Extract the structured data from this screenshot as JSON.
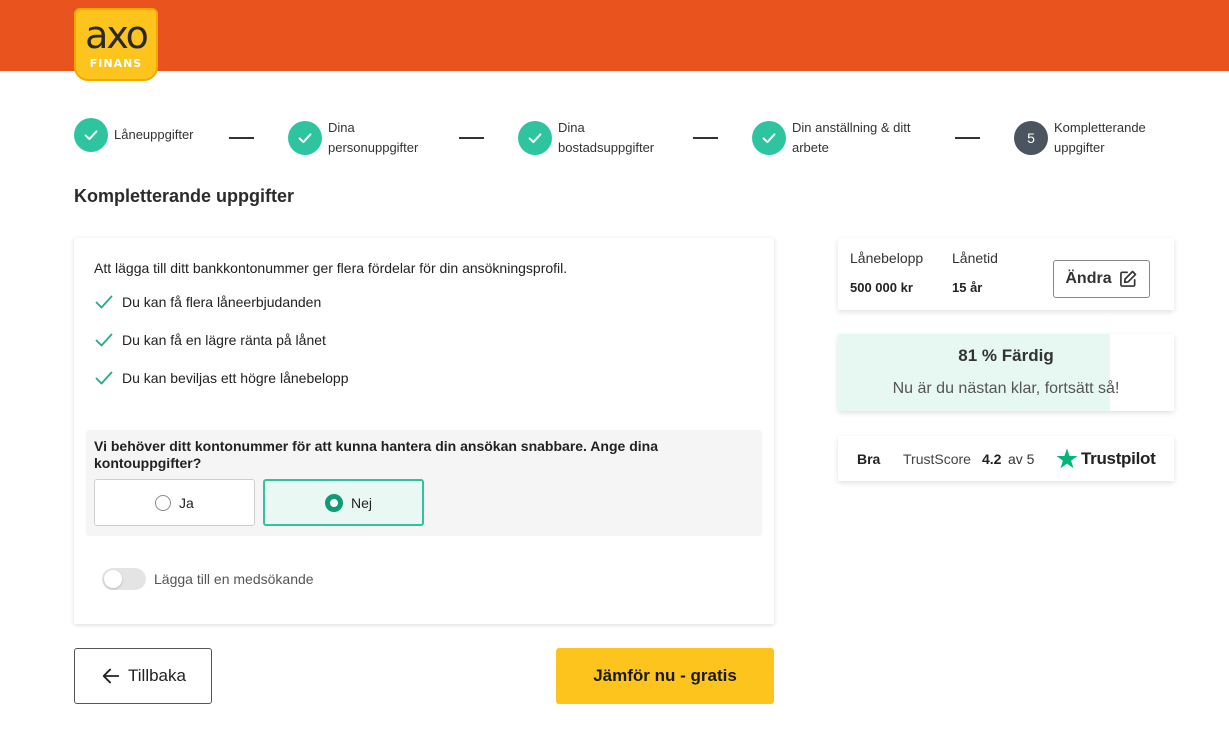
{
  "brand": {
    "logo_main": "axo",
    "logo_sub": "FINANS",
    "header_color": "#e8531e",
    "logo_color": "#fcc41c",
    "accent_color": "#2ec4a0"
  },
  "stepper": {
    "steps": [
      {
        "label_line1": "Låneuppgifter",
        "label_line2": "",
        "state": "done",
        "icon": "check-icon"
      },
      {
        "label_line1": "Dina",
        "label_line2": "personuppgifter",
        "state": "done",
        "icon": "check-icon"
      },
      {
        "label_line1": "Dina",
        "label_line2": "bostadsuppgifter",
        "state": "done",
        "icon": "check-icon"
      },
      {
        "label_line1": "Din anställning & ditt",
        "label_line2": "arbete",
        "state": "done",
        "icon": "check-icon"
      },
      {
        "number": "5",
        "label_line1": "Kompletterande",
        "label_line2": "uppgifter",
        "state": "current"
      }
    ]
  },
  "page": {
    "title": "Kompletterande uppgifter"
  },
  "main": {
    "intro": "Att lägga till ditt bankkontonummer ger flera fördelar för din ansökningsprofil.",
    "benefits": [
      "Du kan få flera låneerbjudanden",
      "Du kan få en lägre ränta på lånet",
      "Du kan beviljas ett högre lånebelopp"
    ],
    "question": "Vi behöver ditt kontonummer för att kunna hantera din ansökan snabbare. Ange dina kontouppgifter?",
    "options": {
      "yes": "Ja",
      "no": "Nej",
      "selected": "no"
    },
    "co_applicant_toggle": "Lägga till en medsökande",
    "co_applicant_enabled": false
  },
  "buttons": {
    "back": "Tillbaka",
    "submit": "Jämför nu - gratis"
  },
  "sidebar": {
    "loan": {
      "amount_label": "Lånebelopp",
      "amount_value": "500 000 kr",
      "term_label": "Lånetid",
      "term_value": "15 år",
      "edit_label": "Ändra"
    },
    "progress": {
      "percent": 81,
      "title": "81 % Färdig",
      "subtitle": "Nu är du nästan klar, fortsätt så!"
    },
    "trust": {
      "rating_word": "Bra",
      "score_label": "TrustScore",
      "score_value": "4.2",
      "score_suffix": "av 5",
      "brand": "Trustpilot",
      "brand_color": "#00b67a"
    }
  }
}
